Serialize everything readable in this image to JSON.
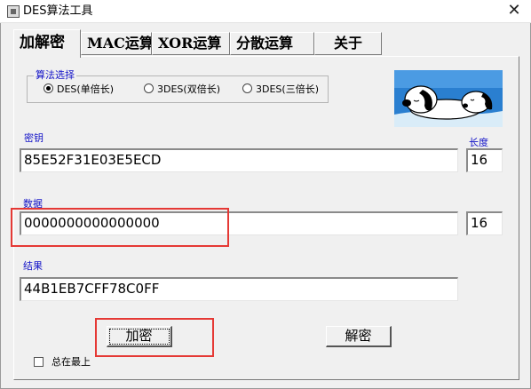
{
  "window": {
    "title": "DES算法工具",
    "close_symbol": "✕"
  },
  "tabs": [
    {
      "label": "加解密",
      "active": true
    },
    {
      "label": "MAC运算",
      "active": false
    },
    {
      "label": "XOR运算",
      "active": false
    },
    {
      "label": "分散运算",
      "active": false
    },
    {
      "label": "关于",
      "active": false
    }
  ],
  "algorithm": {
    "group_label": "算法选择",
    "options": [
      {
        "label": "DES(单倍长)",
        "selected": true
      },
      {
        "label": "3DES(双倍长)",
        "selected": false
      },
      {
        "label": "3DES(三倍长)",
        "selected": false
      }
    ]
  },
  "picture": {
    "icon": "snoopy-image"
  },
  "key": {
    "label": "密钥",
    "value": "85E52F31E03E5ECD",
    "length_label": "长度",
    "length": "16"
  },
  "data": {
    "label": "数据",
    "value": "0000000000000000",
    "length": "16"
  },
  "result": {
    "label": "结果",
    "value": "44B1EB7CFF78C0FF"
  },
  "buttons": {
    "encrypt": "加密",
    "decrypt": "解密"
  },
  "always_on_top": {
    "label": "总在最上",
    "checked": false
  },
  "colors": {
    "label_blue": "#1414c8",
    "highlight_red": "#e53935",
    "window_bg": "#f0f0f0"
  }
}
